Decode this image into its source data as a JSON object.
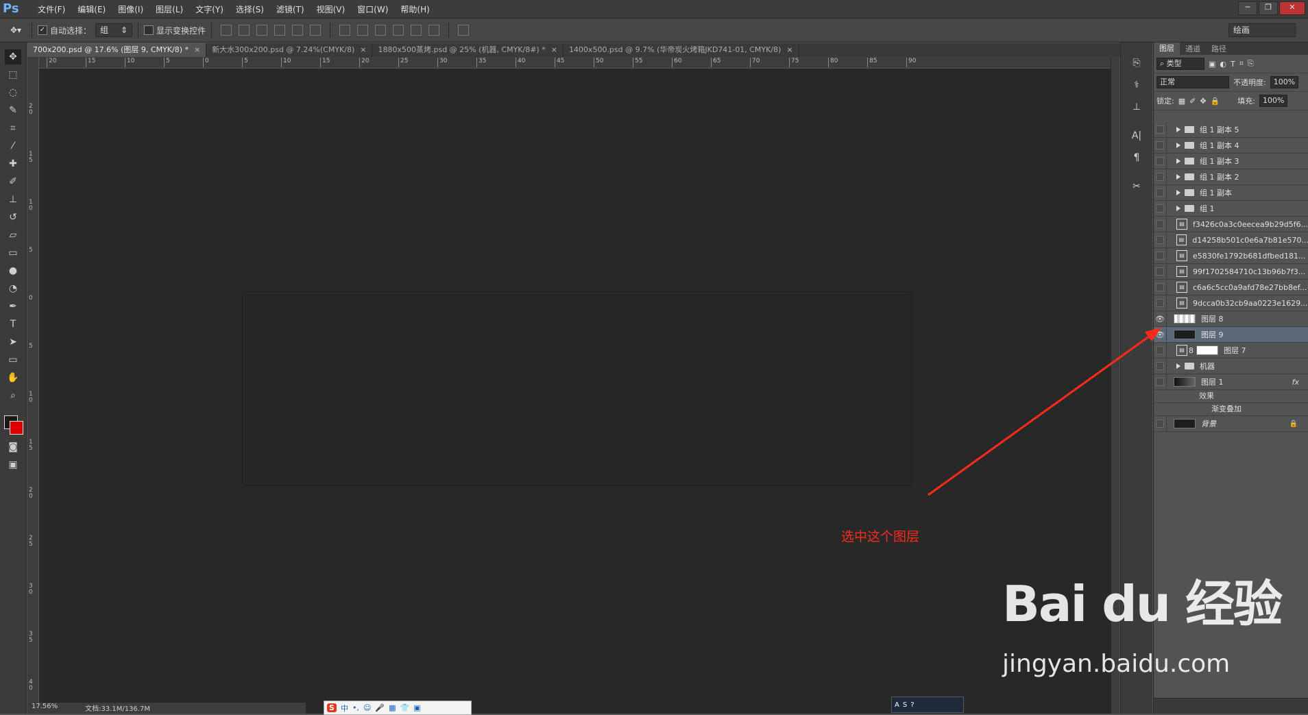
{
  "app": {
    "logo": "Ps"
  },
  "menu": [
    "文件(F)",
    "编辑(E)",
    "图像(I)",
    "图层(L)",
    "文字(Y)",
    "选择(S)",
    "滤镜(T)",
    "视图(V)",
    "窗口(W)",
    "帮助(H)"
  ],
  "options": {
    "auto_select_label": "自动选择：",
    "auto_select_value": "组",
    "show_transform_label": "显示变换控件",
    "workspace": "绘画"
  },
  "tabs": [
    {
      "label": "700x200.psd @ 17.6% (图层 9, CMYK/8) *",
      "close": "×"
    },
    {
      "label": "新大水300x200.psd @ 7.24%(CMYK/8)",
      "close": "×"
    },
    {
      "label": "1880x500蒸烤.psd @ 25% (机器, CMYK/8#) *",
      "close": "×"
    },
    {
      "label": "1400x500.psd @ 9.7% (华帝炭火烤箱JKD741-01, CMYK/8)",
      "close": "×"
    }
  ],
  "ruler_h": [
    "20",
    "15",
    "10",
    "5",
    "0",
    "5",
    "10",
    "15",
    "20",
    "25",
    "30",
    "35",
    "40",
    "45",
    "50",
    "55",
    "60",
    "65",
    "70",
    "75",
    "80",
    "85",
    "90"
  ],
  "ruler_v": [
    "2\n0",
    "1\n5",
    "1\n0",
    "5",
    "0",
    "5",
    "1\n0",
    "1\n5",
    "2\n0",
    "2\n5",
    "3\n0",
    "3\n5",
    "4\n0"
  ],
  "panel": {
    "tabs": [
      "图层",
      "通道",
      "路径"
    ],
    "filter_label": "类型",
    "blend_mode": "正常",
    "opacity_label": "不透明度:",
    "opacity_value": "100%",
    "lock_label": "锁定:",
    "fill_label": "填充:",
    "fill_value": "100%"
  },
  "layers": [
    {
      "name": "组 1 副本 5",
      "kind": "group"
    },
    {
      "name": "组 1 副本 4",
      "kind": "group"
    },
    {
      "name": "组 1 副本 3",
      "kind": "group"
    },
    {
      "name": "组 1 副本 2",
      "kind": "group"
    },
    {
      "name": "组 1 副本",
      "kind": "group"
    },
    {
      "name": "组 1",
      "kind": "group"
    },
    {
      "name": "f3426c0a3c0eecea9b29d5f6...",
      "kind": "smart"
    },
    {
      "name": "d14258b501c0e6a7b81e570...",
      "kind": "smart"
    },
    {
      "name": "e5830fe1792b681dfbed181...",
      "kind": "smart"
    },
    {
      "name": "99f1702584710c13b96b7f3...",
      "kind": "smart"
    },
    {
      "name": "c6a6c5cc0a9afd78e27bb8ef...",
      "kind": "smart"
    },
    {
      "name": "9dcca0b32cb9aa0223e1629...",
      "kind": "smart"
    },
    {
      "name": "图层 8",
      "kind": "checker",
      "visible": true
    },
    {
      "name": "图层 9",
      "kind": "dark",
      "visible": true,
      "selected": true
    },
    {
      "name": "图层 7",
      "kind": "masked"
    },
    {
      "name": "机器",
      "kind": "group"
    },
    {
      "name": "图层 1",
      "kind": "grad",
      "fx": "fx",
      "effects_label": "效果",
      "effect": "渐变叠加"
    },
    {
      "name": "背景",
      "kind": "bg"
    }
  ],
  "status": {
    "zoom": "17.56%",
    "doc": "文档:33.1M/136.7M"
  },
  "annotation": {
    "text": "选中这个图层",
    "color": "#ff2a1a"
  },
  "ime": {
    "s": "S",
    "items": [
      "中",
      "•,",
      "☺",
      "🎤",
      "▦",
      "👕",
      "▣"
    ]
  },
  "tray": {
    "items": [
      "A",
      "S",
      "?"
    ]
  },
  "watermark": {
    "logo": "Bai du 经验",
    "url": "jingyan.baidu.com"
  }
}
